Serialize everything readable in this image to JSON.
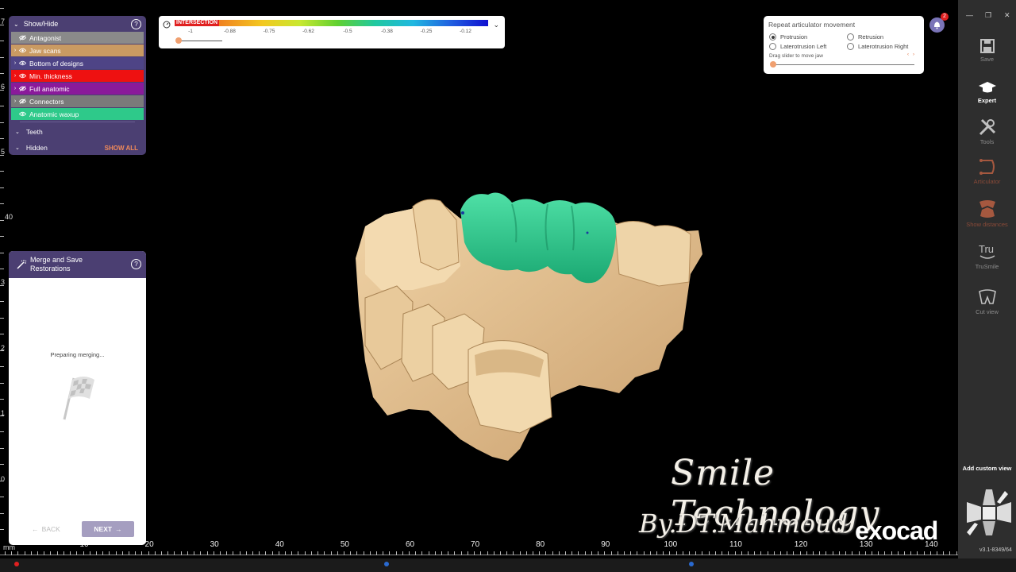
{
  "layers_panel": {
    "title": "Show/Hide",
    "layers": [
      {
        "label": "Antagonist",
        "color": "#8a8a8a",
        "visible": false,
        "expandable": false
      },
      {
        "label": "Jaw scans",
        "color": "#c99a62",
        "visible": true,
        "expandable": true
      },
      {
        "label": "Bottom of designs",
        "color": "#4e4486",
        "visible": true,
        "expandable": true
      },
      {
        "label": "Min. thickness",
        "color": "#ee1111",
        "visible": true,
        "expandable": true
      },
      {
        "label": "Full anatomic",
        "color": "#8a1a9a",
        "visible": false,
        "expandable": true
      },
      {
        "label": "Connectors",
        "color": "#7a7a7a",
        "visible": false,
        "expandable": true
      },
      {
        "label": "Anatomic waxup",
        "color": "#2ec98a",
        "visible": true,
        "expandable": false
      }
    ],
    "teeth_label": "Teeth",
    "hidden_label": "Hidden",
    "show_all_label": "SHOW ALL"
  },
  "merge_panel": {
    "title": "Merge and Save Restorations",
    "status": "Preparing merging...",
    "back_label": "BACK",
    "next_label": "NEXT"
  },
  "color_scale": {
    "intersection_label": "INTERSECTION",
    "tick_labels": [
      "-1",
      "-0.88",
      "-0.75",
      "-0.62",
      "-0.5",
      "-0.38",
      "-0.25",
      "-0.12"
    ]
  },
  "articulator": {
    "title": "Repeat articulator movement",
    "options": [
      "Protrusion",
      "Retrusion",
      "Laterotrusion Left",
      "Laterotrusion Right"
    ],
    "selected": "Protrusion",
    "slider_hint": "Drag slider to move jaw"
  },
  "notifications": {
    "count": "2"
  },
  "toolbar": {
    "tools": [
      {
        "label": "Save",
        "icon": "save-icon",
        "enabled": false
      },
      {
        "label": "Expert",
        "icon": "graduation-cap-icon",
        "enabled": true
      },
      {
        "label": "Tools",
        "icon": "tools-icon",
        "enabled": false
      },
      {
        "label": "Articulator",
        "icon": "articulator-icon",
        "enabled": false
      },
      {
        "label": "Show distances",
        "icon": "distances-icon",
        "enabled": false
      },
      {
        "label": "TruSmile",
        "icon": "trusmile-icon",
        "enabled": false
      },
      {
        "label": "Cut view",
        "icon": "cut-view-icon",
        "enabled": false
      }
    ],
    "add_custom_view": "Add custom view",
    "version": "v3.1-8349/64"
  },
  "ruler": {
    "unit": "mm",
    "x_labels": [
      "10",
      "20",
      "30",
      "40",
      "50",
      "60",
      "70",
      "80",
      "90",
      "100",
      "110",
      "120",
      "130",
      "140"
    ],
    "y_labels": [
      "7",
      "6",
      "5",
      "40",
      "3",
      "2",
      "1",
      "0"
    ]
  },
  "watermark": {
    "line1": "Smile Technology",
    "line2": "By.DT.Mahmoud",
    "brand": "exocad"
  }
}
